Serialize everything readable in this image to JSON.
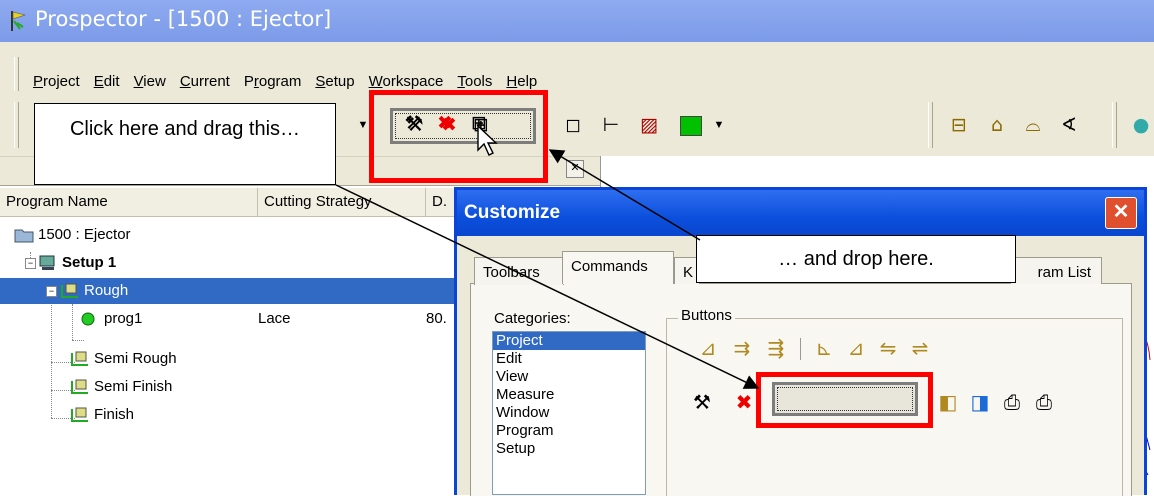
{
  "window": {
    "title": "Prospector - [1500 : Ejector]",
    "app_icon": "prospector-icon"
  },
  "menu": {
    "items": [
      {
        "label": "Project",
        "accel": "P",
        "rest": "roject"
      },
      {
        "label": "Edit",
        "accel": "E",
        "rest": "dit"
      },
      {
        "label": "View",
        "accel": "V",
        "rest": "iew"
      },
      {
        "label": "Current",
        "accel": "C",
        "rest": "urrent"
      },
      {
        "label": "Program",
        "pre": "P",
        "accel": "r",
        "rest": "ogram"
      },
      {
        "label": "Setup",
        "accel": "S",
        "rest": "etup"
      },
      {
        "label": "Workspace",
        "accel": "W",
        "rest": "orkspace"
      },
      {
        "label": "Tools",
        "accel": "T",
        "rest": "ools"
      },
      {
        "label": "Help",
        "accel": "H",
        "rest": "elp"
      }
    ]
  },
  "program_list": {
    "columns": [
      "Program Name",
      "Cutting Strategy",
      "D."
    ],
    "rows": [
      {
        "name": "1500 : Ejector",
        "strategy": "",
        "d": ""
      },
      {
        "name": "Setup 1",
        "strategy": "",
        "d": ""
      },
      {
        "name": "Rough",
        "strategy": "",
        "d": ""
      },
      {
        "name": "prog1",
        "strategy": "Lace",
        "d": "80."
      },
      {
        "name": "Semi Rough",
        "strategy": "",
        "d": ""
      },
      {
        "name": "Semi Finish",
        "strategy": "",
        "d": ""
      },
      {
        "name": "Finish",
        "strategy": "",
        "d": ""
      }
    ]
  },
  "dialog": {
    "title": "Customize",
    "close_glyph": "✕",
    "tabs": [
      "Toolbars",
      "Commands",
      "K",
      "ram List"
    ],
    "categories_label": "Categories:",
    "categories": [
      "Project",
      "Edit",
      "View",
      "Measure",
      "Window",
      "Program",
      "Setup"
    ],
    "selected_category": "Project",
    "buttons_label": "Buttons"
  },
  "annotations": {
    "drag_text": "Click here and drag this…",
    "drop_text": "… and drop here."
  },
  "colors": {
    "highlight_red": "#ff0000",
    "title_blue": "#0a46cf",
    "selection_blue": "#316ac5"
  }
}
